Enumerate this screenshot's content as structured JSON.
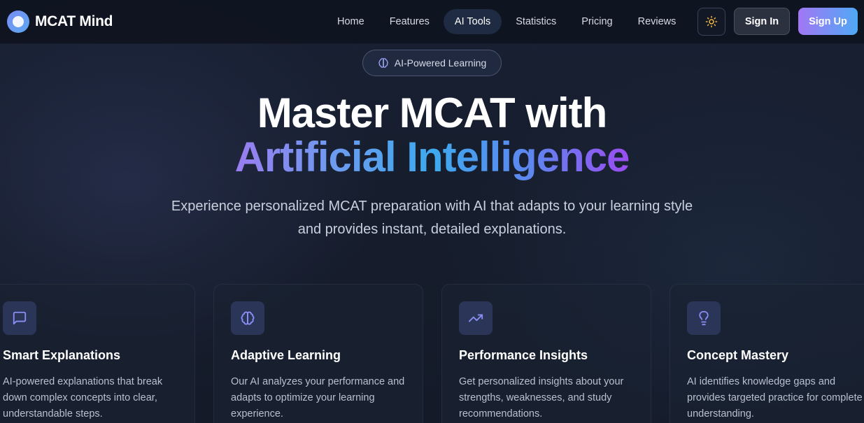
{
  "brand": {
    "name": "MCAT Mind"
  },
  "nav": {
    "links": [
      {
        "label": "Home",
        "active": false
      },
      {
        "label": "Features",
        "active": false
      },
      {
        "label": "AI Tools",
        "active": true
      },
      {
        "label": "Statistics",
        "active": false
      },
      {
        "label": "Pricing",
        "active": false
      },
      {
        "label": "Reviews",
        "active": false
      }
    ],
    "theme_toggle_icon": "sun-icon",
    "sign_in": "Sign In",
    "sign_up": "Sign Up"
  },
  "hero": {
    "badge": "AI-Powered Learning",
    "title_line1": "Master MCAT with",
    "title_line2": "Artificial Intelligence",
    "subtitle": "Experience personalized MCAT preparation with AI that adapts to your learning style and provides instant, detailed explanations."
  },
  "features": [
    {
      "icon": "message-square-icon",
      "title": "Smart Explanations",
      "description": "AI-powered explanations that break down complex concepts into clear, understandable steps."
    },
    {
      "icon": "brain-icon",
      "title": "Adaptive Learning",
      "description": "Our AI analyzes your performance and adapts to optimize your learning experience."
    },
    {
      "icon": "trending-up-icon",
      "title": "Performance Insights",
      "description": "Get personalized insights about your strengths, weaknesses, and study recommendations."
    },
    {
      "icon": "lightbulb-icon",
      "title": "Concept Mastery",
      "description": "AI identifies knowledge gaps and provides targeted practice for complete understanding."
    }
  ],
  "colors": {
    "accent_purple": "#a277f5",
    "accent_blue": "#4fa9f5",
    "icon_color": "#8b8ff5",
    "sun_color": "#f5b83d"
  }
}
